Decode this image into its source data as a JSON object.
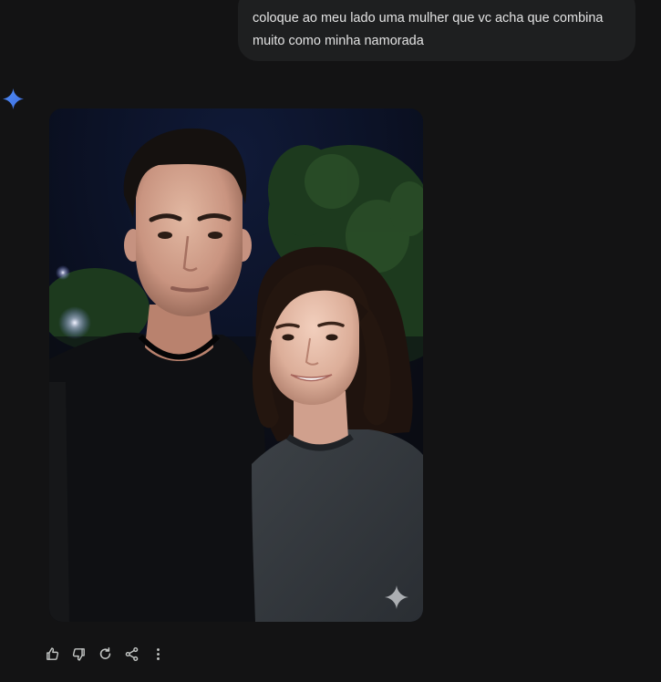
{
  "conversation": {
    "user_prompt": "coloque ao meu lado uma mulher que vc acha que combina\nmuito como minha namorada"
  },
  "response": {
    "assistant_icon": "gemini-sparkle-icon",
    "image": {
      "content": "photo",
      "badge_icon": "ai-sparkle-icon"
    }
  },
  "actions": [
    {
      "name": "thumbs-up-icon"
    },
    {
      "name": "thumbs-down-icon"
    },
    {
      "name": "regenerate-icon"
    },
    {
      "name": "share-icon"
    },
    {
      "name": "more-vert-icon"
    }
  ],
  "colors": {
    "background": "#131314",
    "bubble": "#1e1f20",
    "text": "#e3e3e3",
    "accent": "#4285f4",
    "icon": "#c4c7c5"
  }
}
